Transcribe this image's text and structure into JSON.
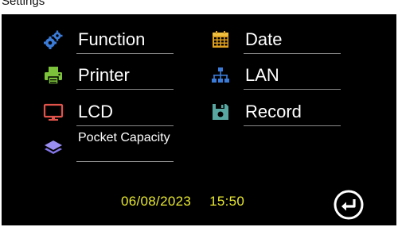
{
  "topbar": {
    "title": "Settings"
  },
  "menu": {
    "items": [
      {
        "label": "Function",
        "icon": "gears-icon"
      },
      {
        "label": "Date",
        "icon": "calendar-icon"
      },
      {
        "label": "Printer",
        "icon": "printer-icon"
      },
      {
        "label": "LAN",
        "icon": "network-icon"
      },
      {
        "label": "LCD",
        "icon": "monitor-icon"
      },
      {
        "label": "Record",
        "icon": "floppy-disk-icon"
      },
      {
        "label": "Pocket Capacity",
        "icon": "layers-icon"
      }
    ]
  },
  "status": {
    "date": "06/08/2023",
    "time": "15:50"
  },
  "back": {
    "icon": "return-arrow-icon"
  },
  "colors": {
    "background": "#000000",
    "text": "#ffffff",
    "clock": "#e8e830",
    "gear": "#3b7bd8",
    "calendar": "#e0a020",
    "printer": "#7cc23a",
    "network": "#3b7bd8",
    "monitor": "#e0524a",
    "floppy": "#58a6a0",
    "layers": "#9a8ef0"
  }
}
